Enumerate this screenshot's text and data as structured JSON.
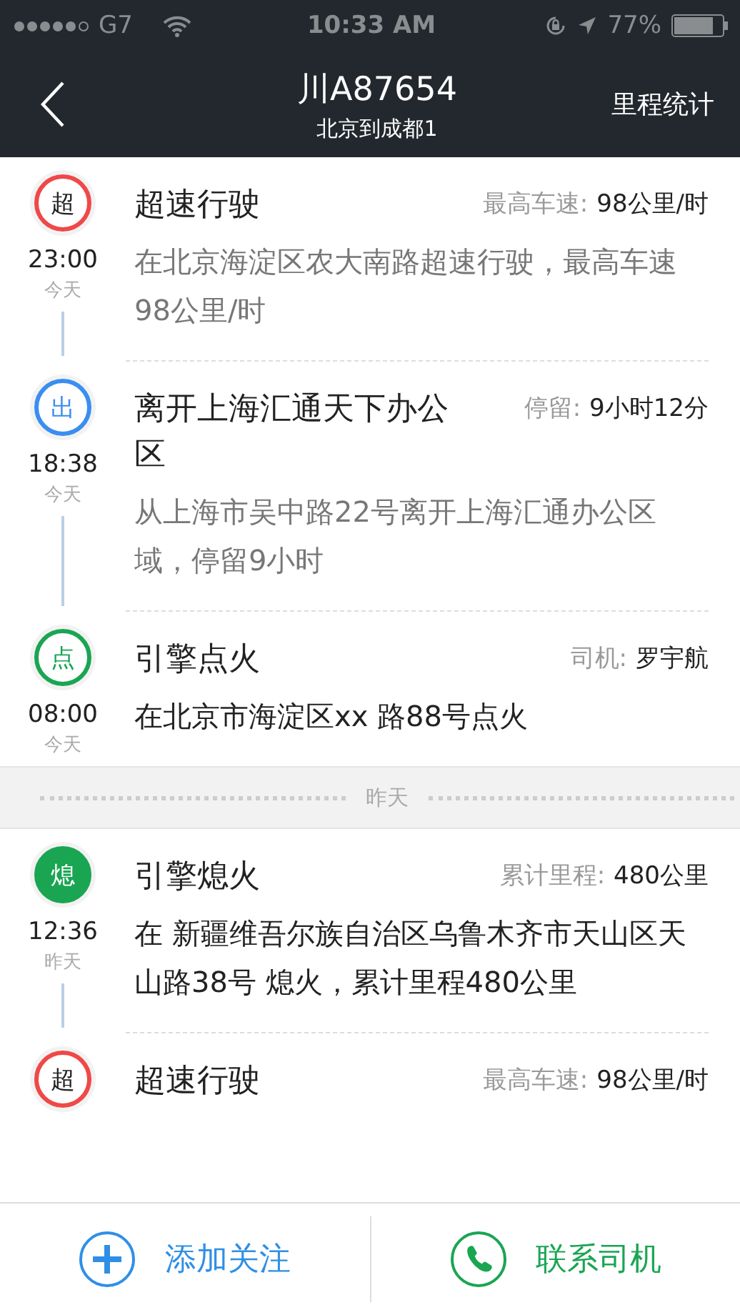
{
  "status_bar": {
    "carrier": "G7",
    "time": "10:33 AM",
    "battery_text": "77%"
  },
  "nav": {
    "title": "川A87654",
    "subtitle": "北京到成都1",
    "action": "里程统计"
  },
  "groups": [
    {
      "events": [
        {
          "badge": "超",
          "color": "#f04848",
          "filled": false,
          "title": "超速行驶",
          "meta_label": "最高车速:",
          "meta_value": "98公里/时",
          "time": "23:00",
          "day": "今天",
          "description": "在北京海淀区农大南路超速行驶，最高车速98公里/时",
          "emphasized": false
        },
        {
          "badge": "出",
          "color": "#3a8ef0",
          "filled": false,
          "title": "离开上海汇通天下办公区",
          "meta_label": "停留:",
          "meta_value": "9小时12分",
          "time": "18:38",
          "day": "今天",
          "description": "从上海市吴中路22号离开上海汇通办公区域，停留9小时",
          "emphasized": false
        },
        {
          "badge": "点",
          "color": "#1aa553",
          "filled": false,
          "title": "引擎点火",
          "meta_label": "司机:",
          "meta_value": "罗宇航",
          "time": "08:00",
          "day": "今天",
          "description": "在北京市海淀区xx 路88号点火",
          "emphasized": true
        }
      ]
    },
    {
      "separator": "昨天",
      "events": [
        {
          "badge": "熄",
          "color": "#1aa553",
          "filled": true,
          "title": "引擎熄火",
          "meta_label": "累计里程:",
          "meta_value": "480公里",
          "time": "12:36",
          "day": "昨天",
          "description": "在 新疆维吾尔族自治区乌鲁木齐市天山区天山路38号 熄火，累计里程480公里",
          "emphasized": true
        },
        {
          "badge": "超",
          "color": "#f04848",
          "filled": false,
          "title": "超速行驶",
          "meta_label": "最高车速:",
          "meta_value": "98公里/时"
        }
      ]
    }
  ],
  "bottom_bar": [
    {
      "kind": "follow",
      "label": "添加关注"
    },
    {
      "kind": "call",
      "label": "联系司机"
    }
  ]
}
